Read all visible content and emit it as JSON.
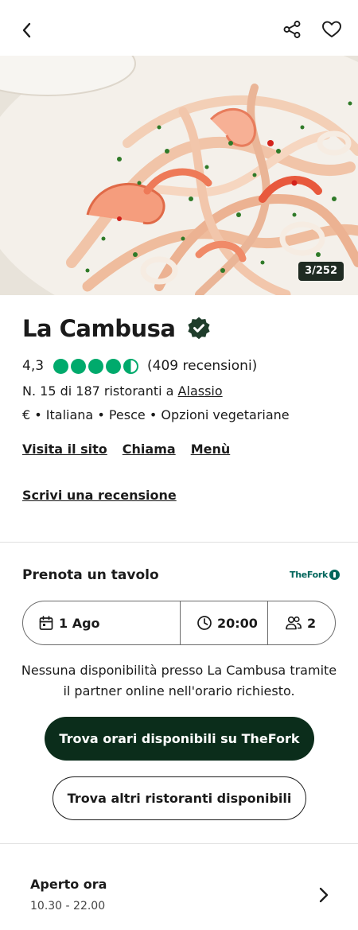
{
  "restaurant": {
    "name": "La Cambusa",
    "rating": "4,3",
    "rating_value": 4.5,
    "reviews": "(409 recensioni)",
    "rank_prefix": "N. 15 di 187 ristoranti a ",
    "rank_city": "Alassio",
    "cuisines": "€ • Italiana • Pesce • Opzioni vegetariane"
  },
  "gallery": {
    "counter": "3/252"
  },
  "actions": {
    "website": "Visita il sito",
    "call": "Chiama",
    "menu": "Menù",
    "write_review": "Scrivi una recensione"
  },
  "booking": {
    "title": "Prenota un tavolo",
    "partner": "TheFork",
    "date": "1 Ago",
    "time": "20:00",
    "party_size": "2",
    "message": "Nessuna disponibilità presso La Cambusa tramite il partner online nell'orario richiesto.",
    "primary_button": "Trova orari disponibili su TheFork",
    "secondary_button": "Trova altri ristoranti disponibili"
  },
  "hours": {
    "status": "Aperto ora",
    "time": "10.30 - 22.00"
  },
  "colors": {
    "rating_green": "#00aa6c",
    "primary_dark": "#0b2d1b",
    "thefork_teal": "#00665c",
    "verified": "#1f3d2b"
  },
  "icons": {
    "back": "chevron-left-icon",
    "share": "share-icon",
    "favorite": "heart-icon",
    "verified": "verified-badge-icon",
    "calendar": "calendar-icon",
    "clock": "clock-icon",
    "people": "people-icon",
    "chevron": "chevron-right-icon"
  }
}
